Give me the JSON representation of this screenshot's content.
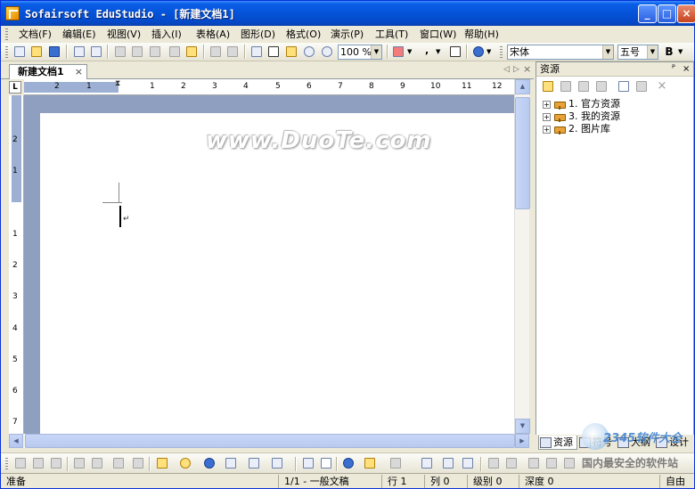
{
  "window": {
    "title": "Sofairsoft EduStudio - [新建文档1]",
    "controls": [
      "_",
      "□",
      "×"
    ]
  },
  "menu": [
    "文档(F)",
    "编辑(E)",
    "视图(V)",
    "插入(I)",
    "表格(A)",
    "图形(D)",
    "格式(O)",
    "演示(P)",
    "工具(T)",
    "窗口(W)",
    "帮助(H)"
  ],
  "toolbar": {
    "zoom": "100 %",
    "font": "宋体",
    "size": "五号",
    "bold": "B"
  },
  "document": {
    "tab_label": "新建文档1",
    "tab_close": "×",
    "watermark": "www.DuoTe.com",
    "ruler_corner": "L",
    "hruler_numbers": [
      "2",
      "1",
      "1",
      "2",
      "3",
      "4",
      "5",
      "6",
      "7",
      "8",
      "9",
      "10",
      "11",
      "12"
    ],
    "vruler_numbers": [
      "2",
      "1",
      "1",
      "2",
      "3",
      "4",
      "5",
      "6",
      "7"
    ],
    "para_mark": "↵"
  },
  "panel": {
    "title": "资源",
    "pin": "ᴾ",
    "close": "×",
    "tree": [
      {
        "label": "1. 官方资源",
        "state": "+"
      },
      {
        "label": "3. 我的资源",
        "state": "+"
      },
      {
        "label": "2. 图片库",
        "state": "+"
      }
    ],
    "tabs": [
      "资源",
      "符号",
      "大纲",
      "设计"
    ]
  },
  "status": {
    "ready": "准备",
    "page": "1/1 - 一般文稿",
    "line": "行 1",
    "col": "列 0",
    "level": "级别 0",
    "depth": "深度 0",
    "mode": "自由"
  },
  "badge": {
    "brand": "2345软件大全",
    "slogan": "国内最安全的软件站"
  }
}
